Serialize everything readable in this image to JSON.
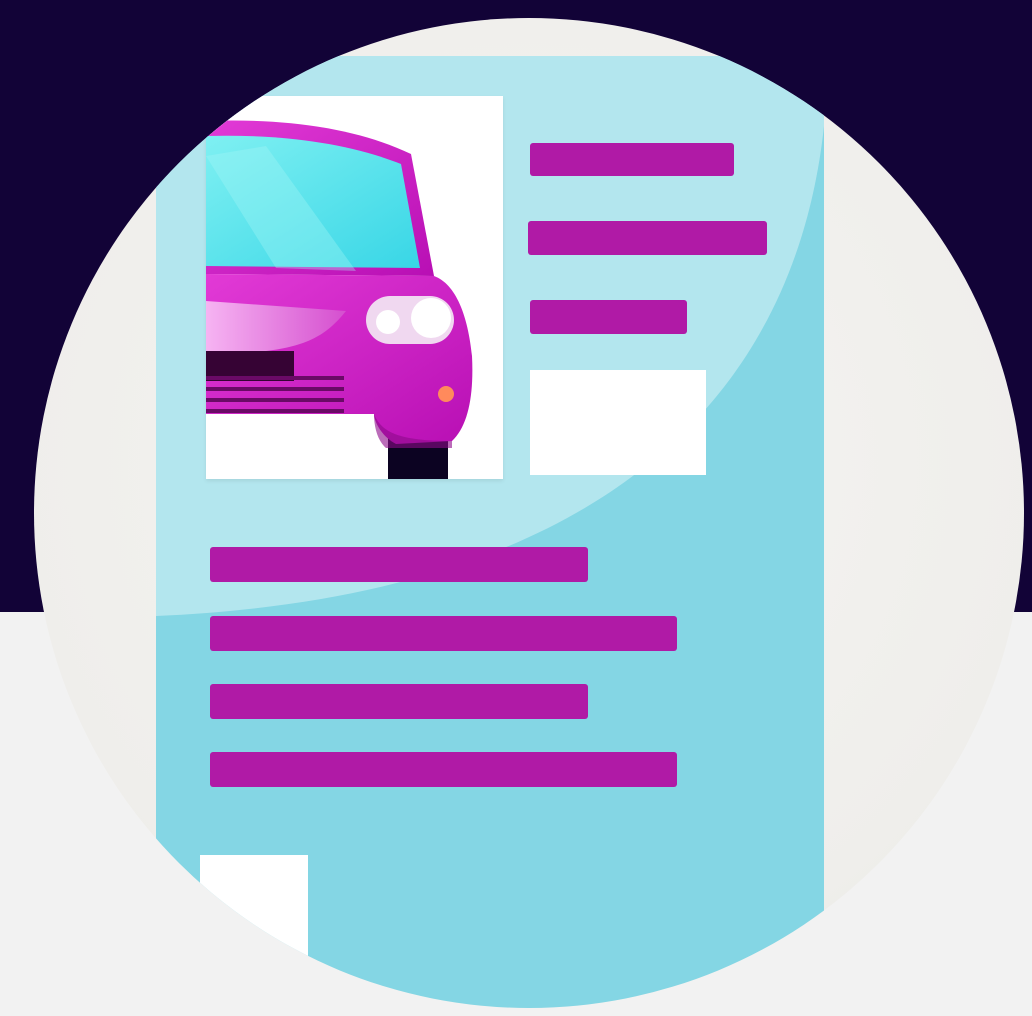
{
  "colors": {
    "background_top": "#120337",
    "background_bottom": "#f2f2f2",
    "circle": "#f1f0ed",
    "document": "#84d6e4",
    "document_sheen": "#bfe9f0",
    "text_line": "#b01aa6",
    "car_body": "#c20dc0",
    "car_windshield": "#55e4ee",
    "car_grille": "#360334",
    "car_tire": "#0c0322",
    "headlight": "#ffffff",
    "indicator": "#ff8a5c",
    "placeholder_box": "#ffffff"
  },
  "illustration": {
    "subject": "document-with-car-icon",
    "car_icon": "car-icon"
  }
}
